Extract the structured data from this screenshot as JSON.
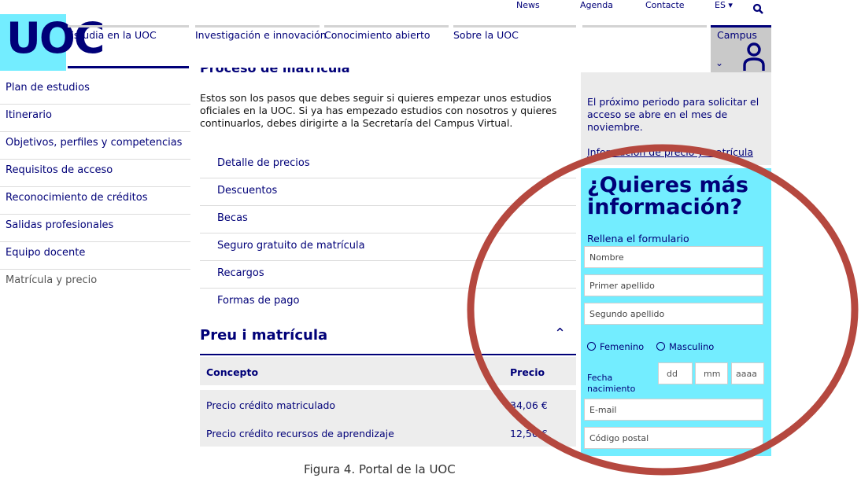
{
  "header": {
    "logo_text": "UOC",
    "top_links": [
      "News",
      "Agenda",
      "Contacte"
    ],
    "language": "ES ▾",
    "nav": [
      "Estudia en la UOC",
      "Investigación e innovación",
      "Conocimiento abierto",
      "Sobre la UOC"
    ],
    "campus_label": "Campus"
  },
  "left_menu": [
    "Plan de estudios",
    "Itinerario",
    "Objetivos, perfiles y competencias",
    "Requisitos de acceso",
    "Reconocimiento de créditos",
    "Salidas profesionales",
    "Equipo docente",
    "Matrícula y precio"
  ],
  "main": {
    "cut_heading": "Proceso de matrícula",
    "intro": "Estos son los pasos que debes seguir si quieres empezar unos estudios oficiales en la UOC. Si ya has empezado estudios con nosotros y quieres continuarlos, debes dirigirte a la Secretaría del Campus Virtual.",
    "sub_items": [
      "Detalle de precios",
      "Descuentos",
      "Becas",
      "Seguro gratuito de matrícula",
      "Recargos",
      "Formas de pago"
    ],
    "section_title": "Preu i matrícula",
    "table": {
      "headers": [
        "Concepto",
        "Precio"
      ],
      "rows": [
        [
          "Precio crédito matriculado",
          "34,06 €"
        ],
        [
          "Precio crédito recursos de aprendizaje",
          "12,50 €"
        ]
      ]
    }
  },
  "sidebar": {
    "notice": "El próximo periodo para solicitar el acceso se abre en el mes de noviembre.",
    "link": "Información de precio y matrícula",
    "form": {
      "title": "¿Quieres más información?",
      "subtitle": "Rellena el formulario",
      "fields": [
        "Nombre",
        "Primer apellido",
        "Segundo apellido"
      ],
      "gender": [
        "Femenino",
        "Masculino"
      ],
      "dob_label": "Fecha nacimiento",
      "dob": [
        "dd",
        "mm",
        "aaaa"
      ],
      "more_fields": [
        "E-mail",
        "Código postal"
      ]
    }
  },
  "annotation": {
    "color": "#b5483f"
  },
  "caption": "Figura 4. Portal de la UOC"
}
